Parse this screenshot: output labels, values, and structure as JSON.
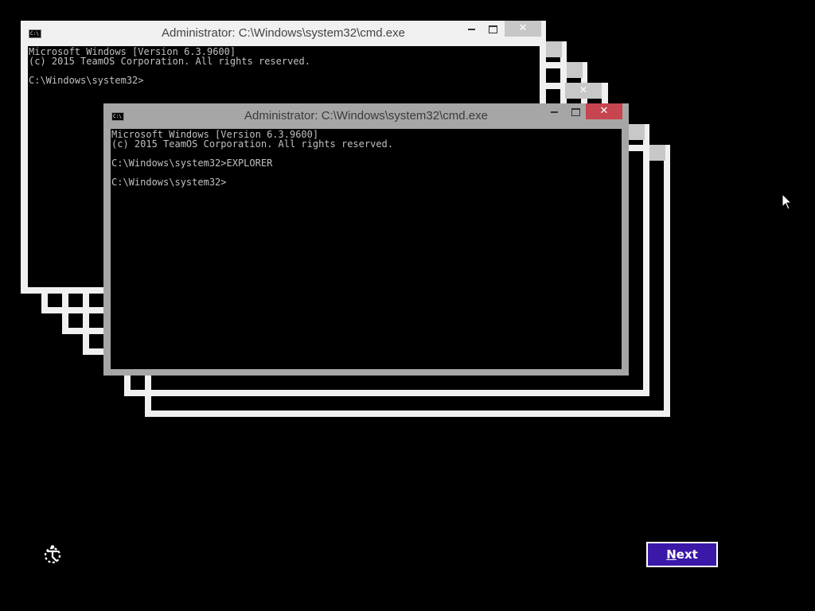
{
  "windows": {
    "back": {
      "title": "Administrator: C:\\Windows\\system32\\cmd.exe",
      "icon_text": "C:\\",
      "console_text": "Microsoft Windows [Version 6.3.9600]\n(c) 2015 TeamOS Corporation. All rights reserved.\n\nC:\\Windows\\system32>"
    },
    "front": {
      "title": "Administrator: C:\\Windows\\system32\\cmd.exe",
      "icon_text": "C:\\",
      "console_text": "Microsoft Windows [Version 6.3.9600]\n(c) 2015 TeamOS Corporation. All rights reserved.\n\nC:\\Windows\\system32>EXPLORER\n\nC:\\Windows\\system32>"
    }
  },
  "controls": {
    "close_glyph": "✕"
  },
  "footer": {
    "next_label_first": "N",
    "next_label_rest": "ext",
    "ease_of_access_icon": "ease-of-access-icon"
  },
  "colors": {
    "desktop": "#000000",
    "next_button": "#3a18a8",
    "close_active": "#c7454e",
    "frame_light": "#f0f0f0",
    "frame_active": "#a6a6a6"
  }
}
